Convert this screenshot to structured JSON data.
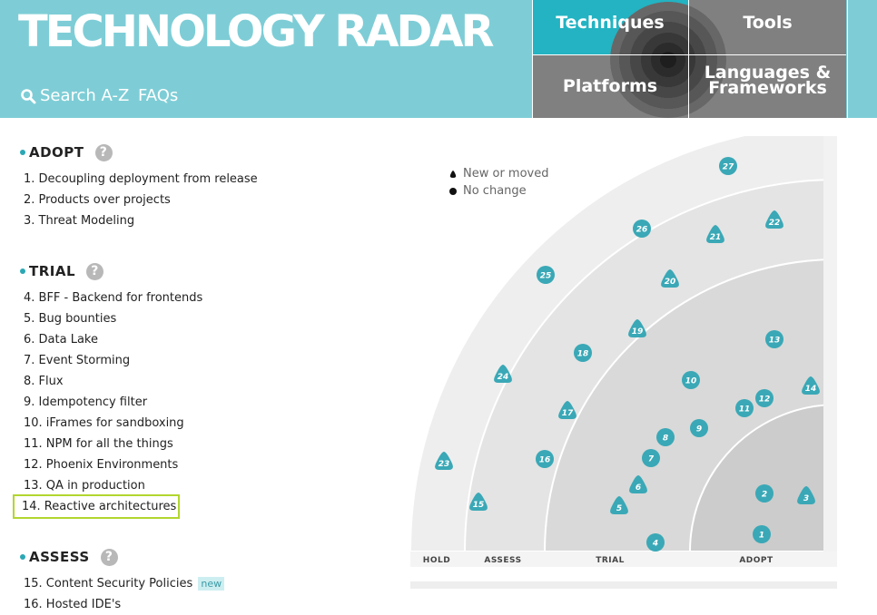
{
  "header": {
    "title": "TECHNOLOGY RADAR",
    "nav": {
      "search": "Search A-Z",
      "faqs": "FAQs"
    },
    "quadrants": {
      "techniques": "Techniques",
      "tools": "Tools",
      "platforms": "Platforms",
      "languages": [
        "Languages &",
        "Frameworks"
      ]
    },
    "colors": {
      "header_bg": "#7ecdd6",
      "active_quadrant": "#23b3c2",
      "inactive_quadrant": "#808080"
    }
  },
  "sections": {
    "adopt": {
      "title": "ADOPT",
      "help": "?",
      "items": [
        "1. Decoupling deployment from release",
        "2. Products over projects",
        "3. Threat Modeling"
      ]
    },
    "trial": {
      "title": "TRIAL",
      "help": "?",
      "items": [
        "4. BFF - Backend for frontends",
        "5. Bug bounties",
        "6. Data Lake",
        "7. Event Storming",
        "8. Flux",
        "9. Idempotency filter",
        "10. iFrames for sandboxing",
        "11. NPM for all the things",
        "12. Phoenix Environments",
        "13. QA in production",
        "14. Reactive architectures"
      ]
    },
    "assess": {
      "title": "ASSESS",
      "help": "?",
      "items": [
        "15. Content Security Policies",
        "16. Hosted IDE's"
      ],
      "new_badge": "new"
    }
  },
  "legend": {
    "new_or_moved": "New or moved",
    "no_change": "No change"
  },
  "radar": {
    "ring_labels": [
      "HOLD",
      "ASSESS",
      "TRIAL",
      "ADOPT"
    ],
    "blip_color": "#3aa8b6",
    "blips": [
      {
        "n": "1",
        "shape": "circle"
      },
      {
        "n": "2",
        "shape": "circle"
      },
      {
        "n": "3",
        "shape": "triangle"
      },
      {
        "n": "4",
        "shape": "circle"
      },
      {
        "n": "5",
        "shape": "triangle"
      },
      {
        "n": "6",
        "shape": "triangle"
      },
      {
        "n": "7",
        "shape": "circle"
      },
      {
        "n": "8",
        "shape": "circle"
      },
      {
        "n": "9",
        "shape": "circle"
      },
      {
        "n": "10",
        "shape": "circle"
      },
      {
        "n": "11",
        "shape": "circle"
      },
      {
        "n": "12",
        "shape": "circle"
      },
      {
        "n": "13",
        "shape": "circle"
      },
      {
        "n": "14",
        "shape": "triangle"
      },
      {
        "n": "15",
        "shape": "triangle"
      },
      {
        "n": "16",
        "shape": "circle"
      },
      {
        "n": "17",
        "shape": "triangle"
      },
      {
        "n": "18",
        "shape": "circle"
      },
      {
        "n": "19",
        "shape": "triangle"
      },
      {
        "n": "20",
        "shape": "triangle"
      },
      {
        "n": "21",
        "shape": "triangle"
      },
      {
        "n": "22",
        "shape": "triangle"
      },
      {
        "n": "23",
        "shape": "triangle"
      },
      {
        "n": "24",
        "shape": "triangle"
      },
      {
        "n": "25",
        "shape": "circle"
      },
      {
        "n": "26",
        "shape": "circle"
      },
      {
        "n": "27",
        "shape": "circle"
      }
    ]
  }
}
